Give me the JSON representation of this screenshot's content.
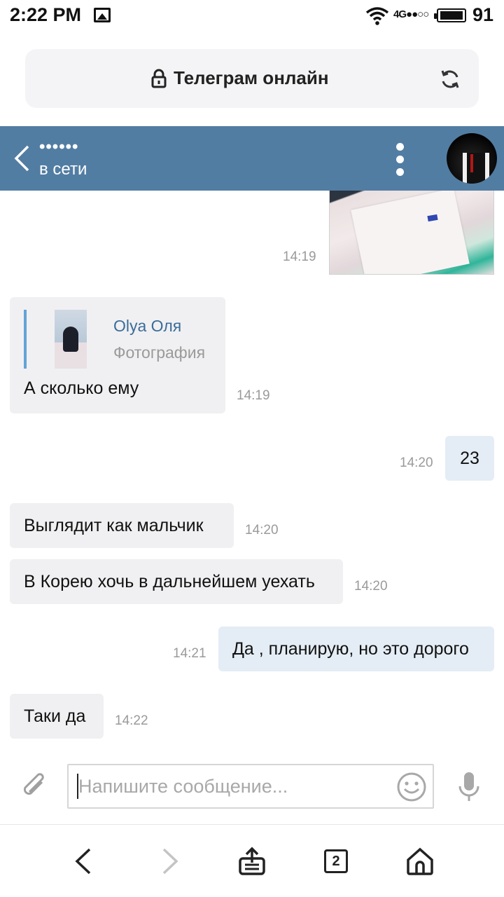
{
  "status_bar": {
    "time": "2:22 PM",
    "network": "4G",
    "network_dots": "●●○○",
    "battery": "91"
  },
  "browser": {
    "url_title": "Телеграм онлайн",
    "tab_count": "2"
  },
  "chat_header": {
    "contact_name": "••••••",
    "contact_status": "в сети"
  },
  "messages": [
    {
      "direction": "out",
      "type": "photo",
      "time": "14:19"
    },
    {
      "direction": "in",
      "type": "reply",
      "reply_author": "Olya Оля",
      "reply_type": "Фотография",
      "text": "А сколько ему",
      "time": "14:19"
    },
    {
      "direction": "out",
      "type": "text",
      "text": "23",
      "time": "14:20"
    },
    {
      "direction": "in",
      "type": "text",
      "text": "Выглядит как мальчик",
      "time": "14:20"
    },
    {
      "direction": "in",
      "type": "text",
      "text": "В Корею хочь в дальнейшем уехать",
      "time": "14:20"
    },
    {
      "direction": "out",
      "type": "text",
      "text": "Да , планирую, но это дорого",
      "time": "14:21"
    },
    {
      "direction": "in",
      "type": "text",
      "text": "Таки да",
      "time": "14:22"
    }
  ],
  "composer": {
    "placeholder": "Напишите сообщение...",
    "value": ""
  },
  "icons": {
    "status_image": "image-icon",
    "wifi": "wifi-icon",
    "lock": "lock-icon",
    "reload": "reload-icon",
    "back": "chevron-left-icon",
    "menu": "more-vertical-icon",
    "attach": "paperclip-icon",
    "emoji": "smiley-icon",
    "mic": "microphone-icon",
    "nav_back": "arrow-back-icon",
    "nav_forward": "arrow-forward-icon",
    "nav_share": "share-icon",
    "nav_tabs": "tabs-icon",
    "nav_home": "home-icon"
  },
  "colors": {
    "header": "#527da3",
    "incoming_bubble": "#f0f0f2",
    "outgoing_bubble": "#e4edf5",
    "reply_accent": "#62a3d9",
    "reply_author": "#3a6d99",
    "timestamp": "#9a9a9a"
  }
}
